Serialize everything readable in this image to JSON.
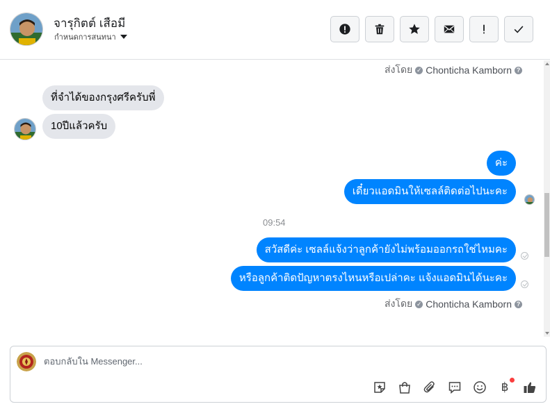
{
  "header": {
    "contact_name": "จารุกิตต์ เสือมี",
    "conversation_settings": "กำหนดการสนทนา",
    "actions": [
      {
        "name": "report-spam",
        "icon": "exclamation-circle-icon"
      },
      {
        "name": "delete",
        "icon": "trash-icon"
      },
      {
        "name": "star",
        "icon": "star-icon"
      },
      {
        "name": "mark-unread",
        "icon": "envelope-icon"
      },
      {
        "name": "priority",
        "icon": "exclamation-icon"
      },
      {
        "name": "mark-done",
        "icon": "checkmark-icon"
      }
    ]
  },
  "thread": {
    "sent_by_label": "ส่งโดย",
    "sent_by_name": "Chonticha Kamborn",
    "incoming": [
      "ที่จำได้ของกรุงศรีครับพี่",
      "10ปีแล้วครับ"
    ],
    "outgoing_1": [
      "ค่ะ",
      "เดี๋ยวแอดมินให้เซลล์ติดต่อไปนะคะ"
    ],
    "timestamp": "09:54",
    "outgoing_2": [
      "สวัสดีค่ะ เซลล์แจ้งว่าลูกค้ายังไม่พร้อมออกรถใช่ไหมคะ",
      "หรือลูกค้าติดปัญหาตรงไหนหรือเปล่าคะ แจ้งแอดมินได้นะคะ"
    ]
  },
  "composer": {
    "placeholder": "ตอบกลับใน Messenger...",
    "baht_symbol": "฿",
    "tools": [
      "sticker-icon",
      "shopping-bag-icon",
      "paperclip-icon",
      "saved-reply-icon",
      "emoji-icon",
      "payment-icon",
      "like-icon"
    ]
  },
  "colors": {
    "outgoing_bubble": "#0084ff",
    "incoming_bubble": "#e4e6eb",
    "notification_dot": "#fa3e3e"
  }
}
